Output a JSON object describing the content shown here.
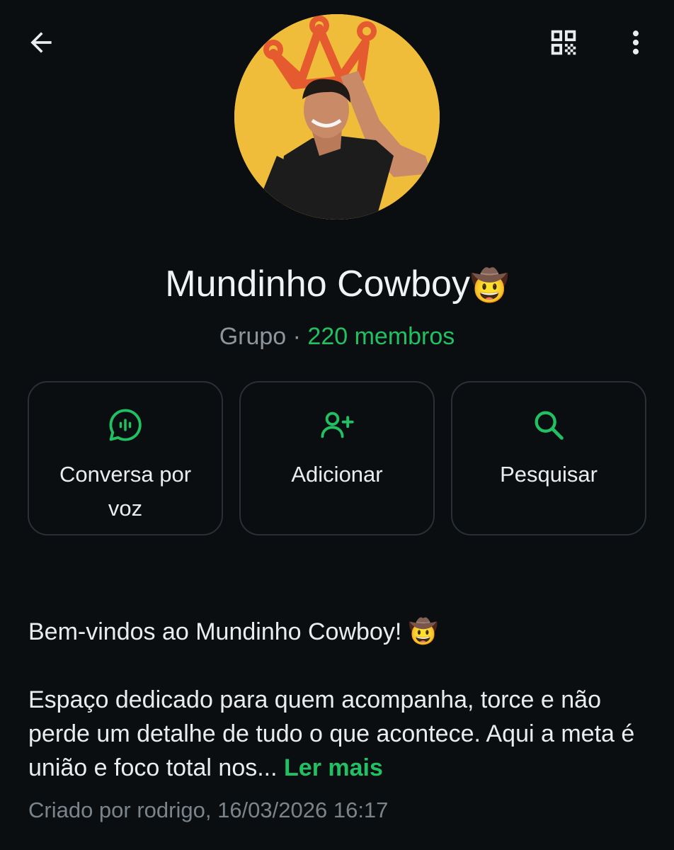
{
  "header": {
    "back_icon": "arrow-left-icon",
    "qr_icon": "qr-code-icon",
    "menu_icon": "more-vertical-icon"
  },
  "group": {
    "name": "Mundinho Cowboy",
    "name_emoji": "🤠",
    "type": "Grupo",
    "separator": " · ",
    "members": "220 membros"
  },
  "actions": [
    {
      "label": "Conversa por voz",
      "icon": "voice-chat-icon"
    },
    {
      "label": "Adicionar",
      "icon": "add-person-icon"
    },
    {
      "label": "Pesquisar",
      "icon": "search-icon"
    }
  ],
  "description": {
    "line1": "Bem-vindos ao Mundinho Cowboy! 🤠",
    "line2": "Espaço dedicado para quem acompanha, torce e não perde um detalhe de tudo o que acontece. Aqui a meta é união e foco total nos...",
    "read_more": "Ler mais"
  },
  "created": "Criado por rodrigo, 16/03/2026 16:17",
  "colors": {
    "background": "#0b0e11",
    "accent": "#21c063",
    "muted_text": "#8d969c",
    "card_border": "#2a3035",
    "avatar_bg": "#f0bd3b"
  }
}
